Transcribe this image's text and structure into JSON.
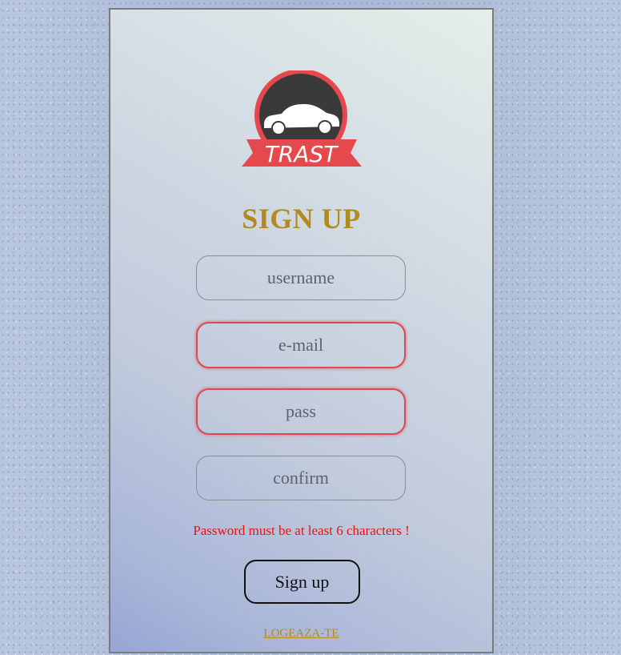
{
  "logo": {
    "text": "TRAST",
    "icon": "car-icon",
    "colors": {
      "ring": "#e5484d",
      "disc": "#3a3a3a",
      "ribbon": "#e5484d",
      "car": "#ffffff"
    }
  },
  "form": {
    "title": "SIGN UP",
    "fields": {
      "username": {
        "placeholder": "username",
        "value": ""
      },
      "email": {
        "placeholder": "e-mail",
        "value": ""
      },
      "password": {
        "placeholder": "pass",
        "value": ""
      },
      "confirm": {
        "placeholder": "confirm",
        "value": ""
      }
    },
    "error_message": "Password must be at least 6 characters !",
    "submit_label": "Sign up",
    "login_link": "LOGEAZA-TE"
  },
  "colors": {
    "accent": "#b48a1e",
    "error": "#ee1111",
    "invalid_border": "#d94a55"
  }
}
